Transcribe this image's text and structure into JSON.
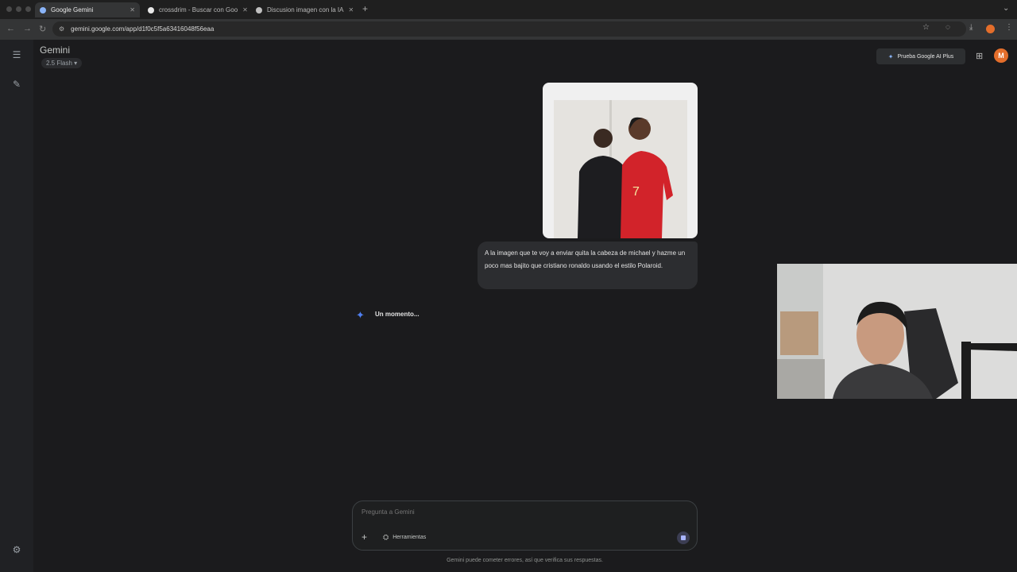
{
  "browser": {
    "tabs": [
      {
        "label": "Google Gemini",
        "active": true
      },
      {
        "label": "crossdrim - Buscar con Goo",
        "active": false
      },
      {
        "label": "Discusion imagen con la IA",
        "active": false
      }
    ],
    "url": "gemini.google.com/app/d1f0c5f5a63416048f56eaa"
  },
  "header": {
    "app_title": "Gemini",
    "model": "2.5 Flash",
    "upgrade_label": "Prueba Google AI Plus",
    "avatar_initial": "M"
  },
  "conversation": {
    "user_message": "A la imagen que te voy a enviar quita la cabeza de michael y hazme un poco mas bajito que cristiano ronaldo usando el estilo Polaroid.",
    "status": "Un momento..."
  },
  "composer": {
    "placeholder": "Pregunta a Gemini",
    "tools_label": "Herramientas",
    "disclaimer": "Gemini puede cometer errores, así que verifica sus respuestas."
  },
  "icons": {
    "menu": "menu-icon",
    "new_chat": "edit-icon",
    "settings": "gear-icon",
    "star": "star-icon",
    "apps": "apps-icon",
    "gemini": "sparkle-icon"
  },
  "colors": {
    "background": "#1b1b1d",
    "accent": "#4f7ff0",
    "avatar": "#e46e2b"
  }
}
